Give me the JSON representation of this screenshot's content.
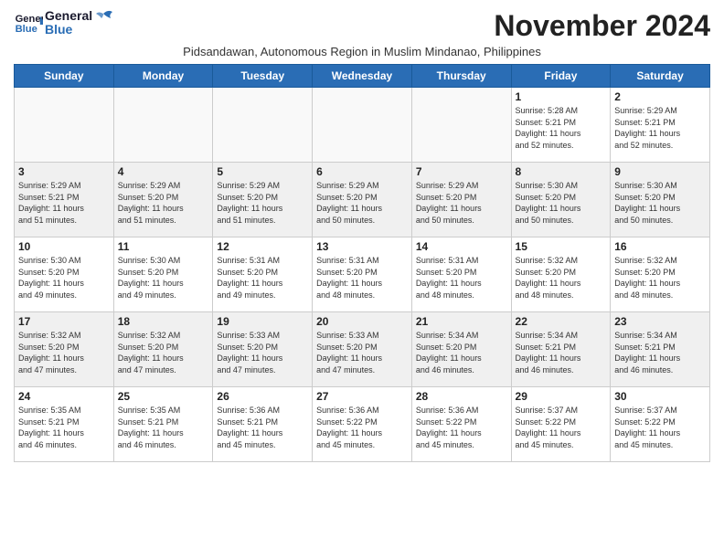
{
  "header": {
    "logo_general": "General",
    "logo_blue": "Blue",
    "month_year": "November 2024",
    "subtitle": "Pidsandawan, Autonomous Region in Muslim Mindanao, Philippines"
  },
  "weekdays": [
    "Sunday",
    "Monday",
    "Tuesday",
    "Wednesday",
    "Thursday",
    "Friday",
    "Saturday"
  ],
  "weeks": [
    [
      {
        "day": "",
        "text": "",
        "empty": true
      },
      {
        "day": "",
        "text": "",
        "empty": true
      },
      {
        "day": "",
        "text": "",
        "empty": true
      },
      {
        "day": "",
        "text": "",
        "empty": true
      },
      {
        "day": "",
        "text": "",
        "empty": true
      },
      {
        "day": "1",
        "text": "Sunrise: 5:28 AM\nSunset: 5:21 PM\nDaylight: 11 hours\nand 52 minutes.",
        "empty": false
      },
      {
        "day": "2",
        "text": "Sunrise: 5:29 AM\nSunset: 5:21 PM\nDaylight: 11 hours\nand 52 minutes.",
        "empty": false
      }
    ],
    [
      {
        "day": "3",
        "text": "Sunrise: 5:29 AM\nSunset: 5:21 PM\nDaylight: 11 hours\nand 51 minutes.",
        "empty": false
      },
      {
        "day": "4",
        "text": "Sunrise: 5:29 AM\nSunset: 5:20 PM\nDaylight: 11 hours\nand 51 minutes.",
        "empty": false
      },
      {
        "day": "5",
        "text": "Sunrise: 5:29 AM\nSunset: 5:20 PM\nDaylight: 11 hours\nand 51 minutes.",
        "empty": false
      },
      {
        "day": "6",
        "text": "Sunrise: 5:29 AM\nSunset: 5:20 PM\nDaylight: 11 hours\nand 50 minutes.",
        "empty": false
      },
      {
        "day": "7",
        "text": "Sunrise: 5:29 AM\nSunset: 5:20 PM\nDaylight: 11 hours\nand 50 minutes.",
        "empty": false
      },
      {
        "day": "8",
        "text": "Sunrise: 5:30 AM\nSunset: 5:20 PM\nDaylight: 11 hours\nand 50 minutes.",
        "empty": false
      },
      {
        "day": "9",
        "text": "Sunrise: 5:30 AM\nSunset: 5:20 PM\nDaylight: 11 hours\nand 50 minutes.",
        "empty": false
      }
    ],
    [
      {
        "day": "10",
        "text": "Sunrise: 5:30 AM\nSunset: 5:20 PM\nDaylight: 11 hours\nand 49 minutes.",
        "empty": false
      },
      {
        "day": "11",
        "text": "Sunrise: 5:30 AM\nSunset: 5:20 PM\nDaylight: 11 hours\nand 49 minutes.",
        "empty": false
      },
      {
        "day": "12",
        "text": "Sunrise: 5:31 AM\nSunset: 5:20 PM\nDaylight: 11 hours\nand 49 minutes.",
        "empty": false
      },
      {
        "day": "13",
        "text": "Sunrise: 5:31 AM\nSunset: 5:20 PM\nDaylight: 11 hours\nand 48 minutes.",
        "empty": false
      },
      {
        "day": "14",
        "text": "Sunrise: 5:31 AM\nSunset: 5:20 PM\nDaylight: 11 hours\nand 48 minutes.",
        "empty": false
      },
      {
        "day": "15",
        "text": "Sunrise: 5:32 AM\nSunset: 5:20 PM\nDaylight: 11 hours\nand 48 minutes.",
        "empty": false
      },
      {
        "day": "16",
        "text": "Sunrise: 5:32 AM\nSunset: 5:20 PM\nDaylight: 11 hours\nand 48 minutes.",
        "empty": false
      }
    ],
    [
      {
        "day": "17",
        "text": "Sunrise: 5:32 AM\nSunset: 5:20 PM\nDaylight: 11 hours\nand 47 minutes.",
        "empty": false
      },
      {
        "day": "18",
        "text": "Sunrise: 5:32 AM\nSunset: 5:20 PM\nDaylight: 11 hours\nand 47 minutes.",
        "empty": false
      },
      {
        "day": "19",
        "text": "Sunrise: 5:33 AM\nSunset: 5:20 PM\nDaylight: 11 hours\nand 47 minutes.",
        "empty": false
      },
      {
        "day": "20",
        "text": "Sunrise: 5:33 AM\nSunset: 5:20 PM\nDaylight: 11 hours\nand 47 minutes.",
        "empty": false
      },
      {
        "day": "21",
        "text": "Sunrise: 5:34 AM\nSunset: 5:20 PM\nDaylight: 11 hours\nand 46 minutes.",
        "empty": false
      },
      {
        "day": "22",
        "text": "Sunrise: 5:34 AM\nSunset: 5:21 PM\nDaylight: 11 hours\nand 46 minutes.",
        "empty": false
      },
      {
        "day": "23",
        "text": "Sunrise: 5:34 AM\nSunset: 5:21 PM\nDaylight: 11 hours\nand 46 minutes.",
        "empty": false
      }
    ],
    [
      {
        "day": "24",
        "text": "Sunrise: 5:35 AM\nSunset: 5:21 PM\nDaylight: 11 hours\nand 46 minutes.",
        "empty": false
      },
      {
        "day": "25",
        "text": "Sunrise: 5:35 AM\nSunset: 5:21 PM\nDaylight: 11 hours\nand 46 minutes.",
        "empty": false
      },
      {
        "day": "26",
        "text": "Sunrise: 5:36 AM\nSunset: 5:21 PM\nDaylight: 11 hours\nand 45 minutes.",
        "empty": false
      },
      {
        "day": "27",
        "text": "Sunrise: 5:36 AM\nSunset: 5:22 PM\nDaylight: 11 hours\nand 45 minutes.",
        "empty": false
      },
      {
        "day": "28",
        "text": "Sunrise: 5:36 AM\nSunset: 5:22 PM\nDaylight: 11 hours\nand 45 minutes.",
        "empty": false
      },
      {
        "day": "29",
        "text": "Sunrise: 5:37 AM\nSunset: 5:22 PM\nDaylight: 11 hours\nand 45 minutes.",
        "empty": false
      },
      {
        "day": "30",
        "text": "Sunrise: 5:37 AM\nSunset: 5:22 PM\nDaylight: 11 hours\nand 45 minutes.",
        "empty": false
      }
    ]
  ]
}
